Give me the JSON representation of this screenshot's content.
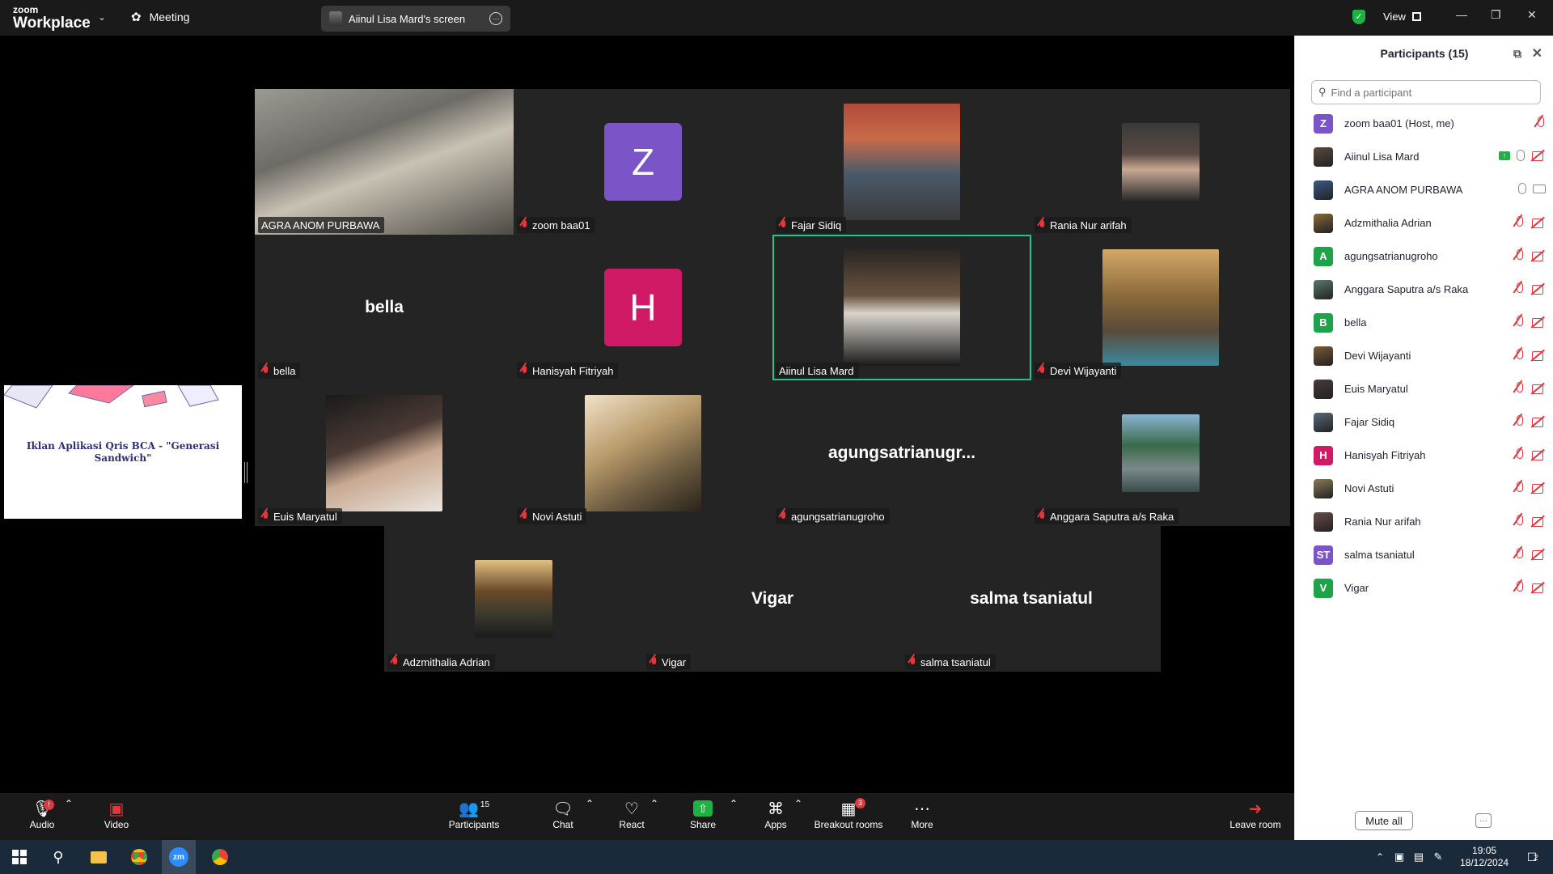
{
  "topbar": {
    "logo_small": "zoom",
    "logo_big": "Workplace",
    "meeting_label": "Meeting",
    "screen_share_label": "Aiinul Lisa Mard's screen",
    "view_label": "View"
  },
  "shared_screen": {
    "title": "Iklan Aplikasi Qris BCA - \"Generasi Sandwich\""
  },
  "gallery": [
    {
      "name": "AGRA ANOM PURBAWA",
      "kind": "video",
      "muted": false
    },
    {
      "name": "zoom baa01",
      "kind": "avatar",
      "initial": "Z",
      "color": "#7b55c7",
      "muted": true
    },
    {
      "name": "Fajar Sidiq",
      "kind": "photo",
      "muted": true
    },
    {
      "name": "Rania Nur arifah",
      "kind": "photo",
      "muted": true
    },
    {
      "name": "bella",
      "kind": "text",
      "display": "bella",
      "muted": true
    },
    {
      "name": "Hanisyah Fitriyah",
      "kind": "avatar",
      "initial": "H",
      "color": "#d01a65",
      "muted": true
    },
    {
      "name": "Aiinul Lisa Mard",
      "kind": "photo",
      "muted": false,
      "active": true
    },
    {
      "name": "Devi Wijayanti",
      "kind": "photo",
      "muted": true
    },
    {
      "name": "Euis Maryatul",
      "kind": "photo",
      "muted": true
    },
    {
      "name": "Novi Astuti",
      "kind": "photo",
      "muted": true
    },
    {
      "name": "agungsatrianugroho",
      "kind": "text",
      "display": "agungsatrianugr...",
      "muted": true
    },
    {
      "name": "Anggara Saputra a/s Raka",
      "kind": "photo",
      "muted": true
    }
  ],
  "gallery_bottom": [
    {
      "name": "Adzmithalia Adrian",
      "kind": "photo",
      "muted": true
    },
    {
      "name": "Vigar",
      "kind": "text",
      "display": "Vigar",
      "muted": true
    },
    {
      "name": "salma tsaniatul",
      "kind": "text",
      "display": "salma tsaniatul",
      "muted": true
    }
  ],
  "panel": {
    "title": "Participants (15)",
    "search_placeholder": "Find a participant",
    "mute_all": "Mute all",
    "participants": [
      {
        "name": "zoom baa01 (Host, me)",
        "initial": "Z",
        "color": "#7b55c7",
        "icons": "mic-off"
      },
      {
        "name": "Aiinul Lisa Mard",
        "initial": "",
        "color": "#5a4a40",
        "icons": "share-mic-camoff"
      },
      {
        "name": "AGRA ANOM PURBAWA",
        "initial": "",
        "color": "#3a5a8a",
        "icons": "mic-cam"
      },
      {
        "name": "Adzmithalia Adrian",
        "initial": "",
        "color": "#8a6a3a",
        "icons": "off-off"
      },
      {
        "name": "agungsatrianugroho",
        "initial": "A",
        "color": "#1fa34a",
        "icons": "off-off"
      },
      {
        "name": "Anggara Saputra a/s Raka",
        "initial": "",
        "color": "#5a7a6a",
        "icons": "off-off"
      },
      {
        "name": "bella",
        "initial": "B",
        "color": "#1fa34a",
        "icons": "off-off"
      },
      {
        "name": "Devi Wijayanti",
        "initial": "",
        "color": "#7a5a3a",
        "icons": "off-off"
      },
      {
        "name": "Euis Maryatul",
        "initial": "",
        "color": "#4a3a3a",
        "icons": "off-off"
      },
      {
        "name": "Fajar Sidiq",
        "initial": "",
        "color": "#5a6a7a",
        "icons": "off-off"
      },
      {
        "name": "Hanisyah Fitriyah",
        "initial": "H",
        "color": "#d01a65",
        "icons": "off-off"
      },
      {
        "name": "Novi Astuti",
        "initial": "",
        "color": "#8a7a5a",
        "icons": "off-off"
      },
      {
        "name": "Rania Nur arifah",
        "initial": "",
        "color": "#6a4a4a",
        "icons": "off-off"
      },
      {
        "name": "salma tsaniatul",
        "initial": "ST",
        "color": "#7b55c7",
        "icons": "off-off"
      },
      {
        "name": "Vigar",
        "initial": "V",
        "color": "#1fa34a",
        "icons": "off-off"
      }
    ]
  },
  "toolbar": {
    "audio": "Audio",
    "video": "Video",
    "participants": "Participants",
    "participants_count": "15",
    "chat": "Chat",
    "react": "React",
    "share": "Share",
    "apps": "Apps",
    "breakout": "Breakout rooms",
    "breakout_badge": "3",
    "more": "More",
    "leave": "Leave room"
  },
  "taskbar": {
    "time": "19:05",
    "date": "18/12/2024",
    "notif_count": "2",
    "zoom_label": "zm"
  }
}
